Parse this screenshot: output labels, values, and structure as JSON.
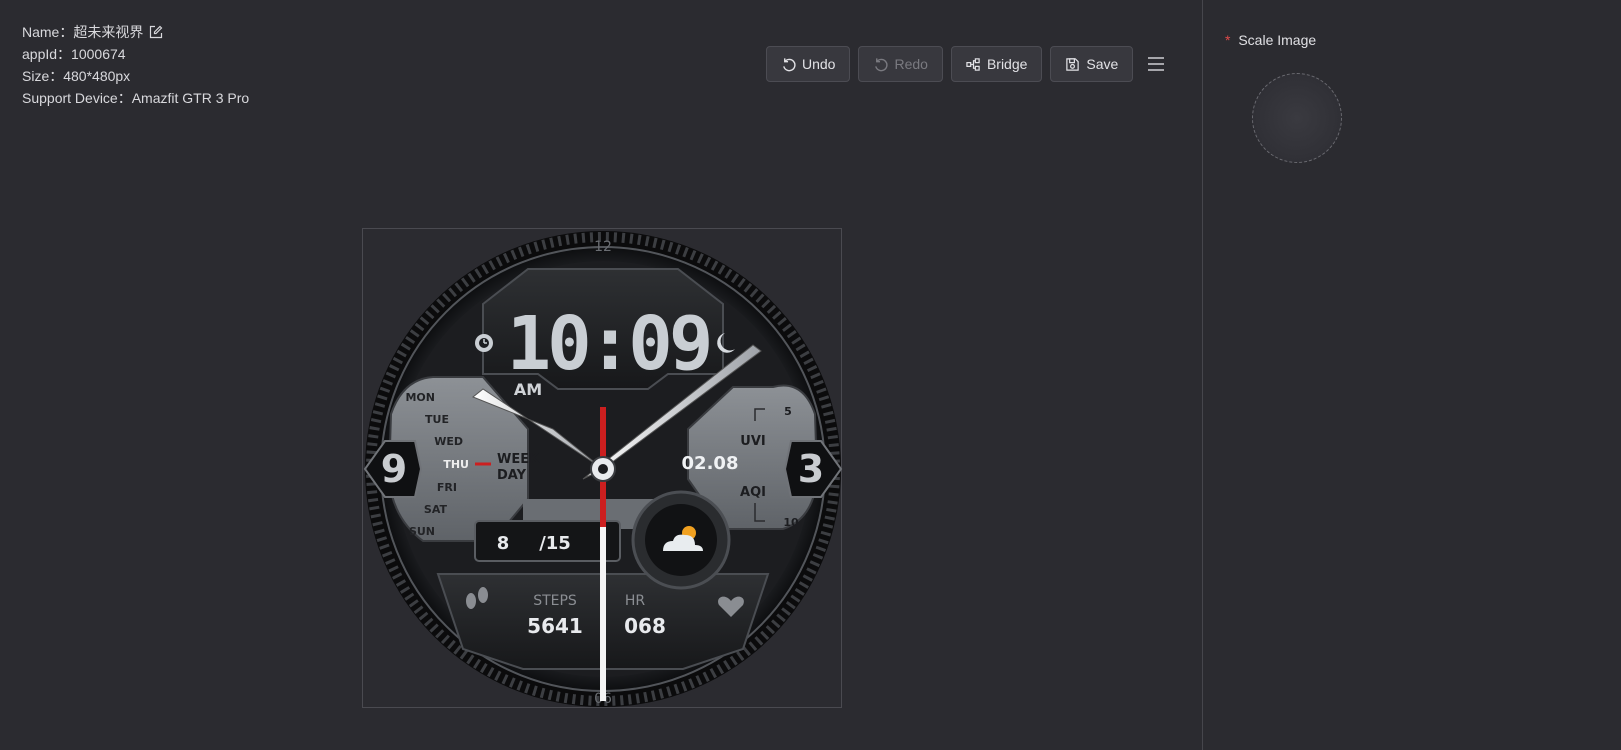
{
  "project": {
    "name_label": "Name：",
    "name_value": "超未来视界",
    "appid_label": "appId：",
    "appid_value": "1000674",
    "size_label": "Size：",
    "size_value": "480*480px",
    "device_label": "Support Device：",
    "device_value": "Amazfit GTR 3 Pro"
  },
  "toolbar": {
    "undo": "Undo",
    "redo": "Redo",
    "bridge": "Bridge",
    "save": "Save"
  },
  "right_panel": {
    "scale_required": "*",
    "scale_label": "Scale Image"
  },
  "watch": {
    "digital_time": "10:09",
    "ampm": "AM",
    "weekdays": [
      "MON",
      "TUE",
      "WED",
      "THU",
      "FRI",
      "SAT",
      "SUN"
    ],
    "active_weekday": "THU",
    "weekday_label_1": "WEEK",
    "weekday_label_2": "DAY",
    "date": "02.08",
    "uvi_label": "UVI",
    "uvi_value": "5",
    "aqi_label": "AQI",
    "aqi_value": "10",
    "temp_now": "8",
    "temp_high": "/15",
    "steps_label": "STEPS",
    "steps_value": "5641",
    "hr_label": "HR",
    "hr_value": "068",
    "numeral_12": "12",
    "numeral_3": "3",
    "numeral_6": "06",
    "numeral_9": "9",
    "accent_color": "#cc1f1f",
    "weather_icon": "partly-cloudy-icon"
  }
}
